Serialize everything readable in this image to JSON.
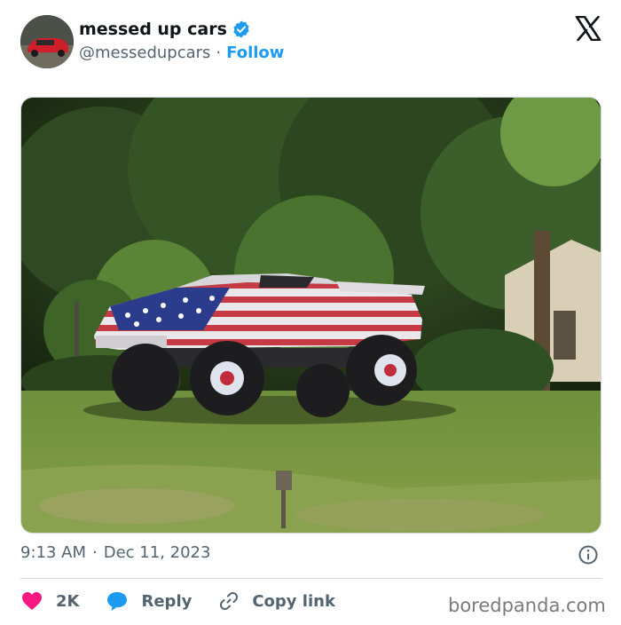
{
  "author": {
    "name": "messed up cars",
    "handle": "@messedupcars",
    "follow_label": "Follow",
    "verified": true
  },
  "icons": {
    "verified": "verified-badge-icon",
    "brand": "x-logo-icon",
    "info": "info-icon",
    "like": "heart-icon",
    "reply": "speech-bubble-icon",
    "copy": "link-icon"
  },
  "post": {
    "time": "9:13 AM",
    "date": "Dec 11, 2023"
  },
  "actions": {
    "likes": "2K",
    "reply_label": "Reply",
    "copy_label": "Copy link"
  },
  "watermark": "boredpanda.com",
  "colors": {
    "accent": "#1d9bf0",
    "like": "#f91880",
    "muted": "#536471"
  }
}
